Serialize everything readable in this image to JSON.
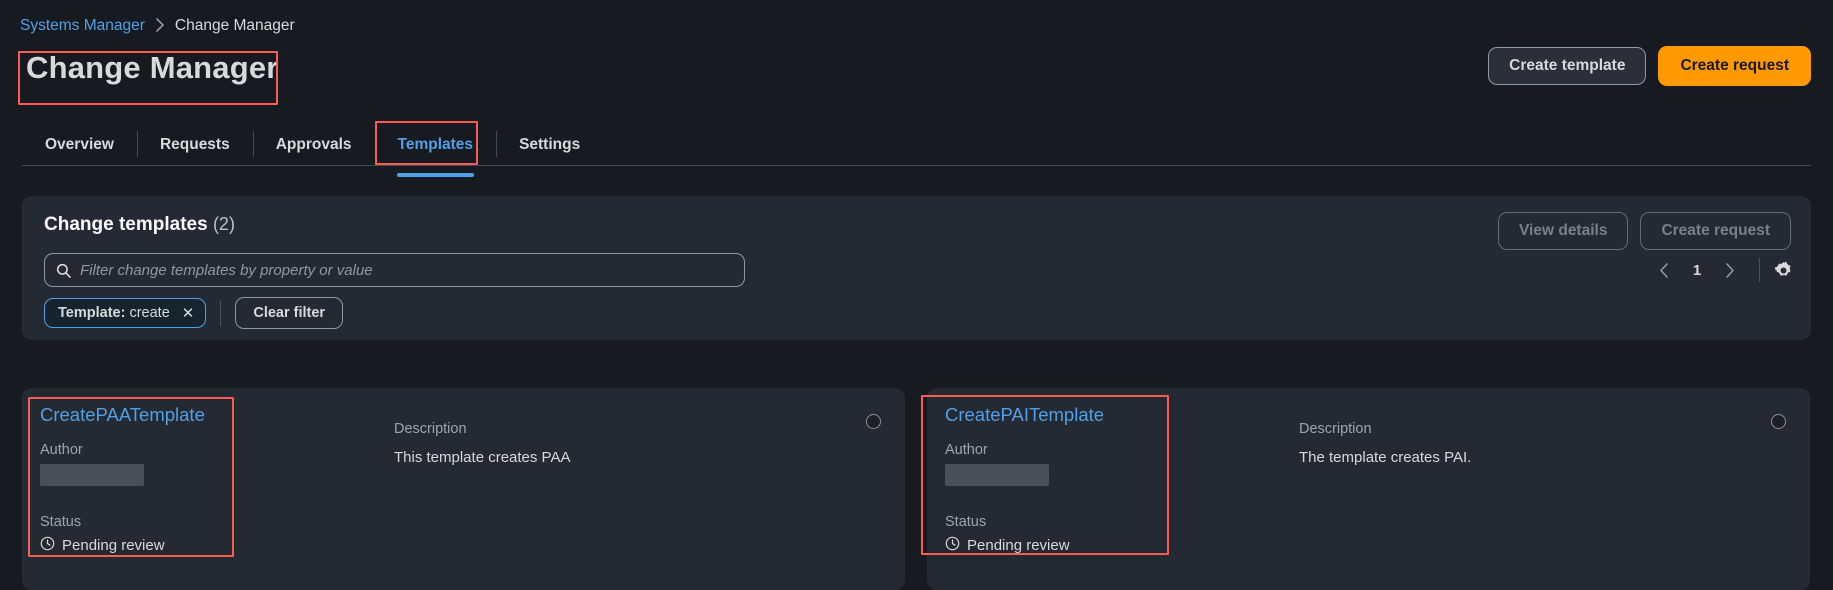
{
  "breadcrumb": {
    "parent": "Systems Manager",
    "separator": "›",
    "current": "Change Manager"
  },
  "page": {
    "title": "Change Manager"
  },
  "header_actions": {
    "create_template": "Create template",
    "create_request": "Create request"
  },
  "tabs": [
    {
      "label": "Overview",
      "active": false
    },
    {
      "label": "Requests",
      "active": false
    },
    {
      "label": "Approvals",
      "active": false
    },
    {
      "label": "Templates",
      "active": true
    },
    {
      "label": "Settings",
      "active": false
    }
  ],
  "panel": {
    "title": "Change templates",
    "count": "(2)",
    "view_details": "View details",
    "create_request": "Create request",
    "search_placeholder": "Filter change templates by property or value",
    "search_value": "",
    "search_icon": "search-icon",
    "pagination": {
      "prev": "‹",
      "page": "1",
      "next": "›",
      "settings_icon": "gear-icon"
    },
    "token": {
      "property": "Template:",
      "value": "create",
      "remove_icon": "✕"
    },
    "clear_filter": "Clear filter"
  },
  "labels": {
    "author": "Author",
    "status": "Status",
    "description": "Description"
  },
  "cards": [
    {
      "name": "CreatePAATemplate",
      "author": "",
      "author_redacted": true,
      "status": "Pending review",
      "status_icon": "clock-icon",
      "description": "This template creates PAA",
      "selected": false
    },
    {
      "name": "CreatePAITemplate",
      "author": "",
      "author_redacted": true,
      "status": "Pending review",
      "status_icon": "clock-icon",
      "description": "The template creates PAI.",
      "selected": false
    }
  ],
  "colors": {
    "page_bg": "#161b22",
    "panel_bg": "#232a33",
    "link": "#539fe5",
    "primary": "#ff9900",
    "annotation": "#fc5b52",
    "muted": "#8d99a8"
  }
}
